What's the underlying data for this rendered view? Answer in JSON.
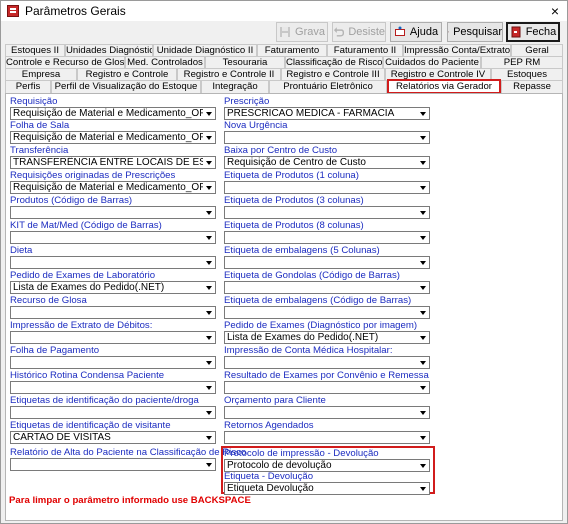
{
  "window": {
    "title": "Parâmetros Gerais",
    "close_glyph": "×"
  },
  "toolbar": {
    "grava": "Grava",
    "desiste": "Desiste",
    "ajuda": "Ajuda",
    "pesquisar": "Pesquisar",
    "fecha": "Fecha"
  },
  "tabs": {
    "row1": [
      "Estoques II",
      "Unidades Diagnóstico",
      "Unidade Diagnóstico II",
      "Faturamento",
      "Faturamento II",
      "Impressão Conta/Extrato",
      "Geral"
    ],
    "row2": [
      "Controle e Recurso de Glosas",
      "Med. Controlados",
      "Tesouraria",
      "Classificação de Risco",
      "Cuidados do Paciente",
      "PEP RM"
    ],
    "row3": [
      "Empresa",
      "Registro e Controle",
      "Registro e Controle II",
      "Registro e Controle III",
      "Registro e Controle IV",
      "Estoques"
    ],
    "row4": [
      "Perfis",
      "Perfil de Visualização do Estoque",
      "Integração",
      "Prontuário Eletrônico",
      "Relatórios via Gerador",
      "Repasse"
    ],
    "selected": "Relatórios via Gerador"
  },
  "left": [
    {
      "label": "Requisição",
      "value": "Requisição de Material e Medicamento_OF"
    },
    {
      "label": "Folha de Sala",
      "value": "Requisição de Material e Medicamento_OF"
    },
    {
      "label": "Transferência",
      "value": "TRANSFERÊNCIA ENTRE LOCAIS DE ESTOQUE"
    },
    {
      "label": "Requisições originadas de Prescrições",
      "value": "Requisição de Material e Medicamento_OF"
    },
    {
      "label": "Produtos (Código de Barras)",
      "value": ""
    },
    {
      "label": "KIT de Mat/Med (Código de Barras)",
      "value": ""
    },
    {
      "label": "Dieta",
      "value": ""
    },
    {
      "label": "Pedido de Exames de Laboratório",
      "value": "Lista de Exames do Pedido(.NET)"
    },
    {
      "label": "Recurso de Glosa",
      "value": ""
    },
    {
      "label": "Impressão de Extrato de Débitos:",
      "value": ""
    },
    {
      "label": "Folha de Pagamento",
      "value": ""
    },
    {
      "label": "Histórico Rotina Condensa Paciente",
      "value": ""
    },
    {
      "label": "Etiquetas de identificação do paciente/droga",
      "value": ""
    },
    {
      "label": "Etiquetas de identificação de visitante",
      "value": "CARTAO DE VISITAS"
    },
    {
      "label": "Relatório de Alta do Paciente na Classificação de Risco",
      "value": ""
    }
  ],
  "right": [
    {
      "label": "Prescrição",
      "value": "PRESCRICAO MEDICA - FARMACIA"
    },
    {
      "label": "Nova Urgência",
      "value": ""
    },
    {
      "label": "Baixa por Centro de Custo",
      "value": "Requisição de Centro de Custo"
    },
    {
      "label": "Etiqueta de Produtos (1 coluna)",
      "value": ""
    },
    {
      "label": "Etiqueta de Produtos (3 colunas)",
      "value": ""
    },
    {
      "label": "Etiqueta de Produtos (8 colunas)",
      "value": ""
    },
    {
      "label": "Etiqueta de embalagens (5 Colunas)",
      "value": ""
    },
    {
      "label": "Etiqueta de Gondolas (Código de Barras)",
      "value": ""
    },
    {
      "label": "Etiqueta de embalagens (Código de Barras)",
      "value": ""
    },
    {
      "label": "Pedido de Exames (Diagnóstico por imagem)",
      "value": "Lista de Exames do Pedido(.NET)"
    },
    {
      "label": "Impressão de Conta Médica Hospitalar:",
      "value": ""
    },
    {
      "label": "Resultado de Exames por Convênio e Remessa",
      "value": ""
    },
    {
      "label": "Orçamento para Cliente",
      "value": ""
    },
    {
      "label": "Retornos Agendados",
      "value": ""
    },
    {
      "label": "Protocolo de impressão - Devolução",
      "value": "Protocolo de devolução"
    },
    {
      "label": "Etiqueta - Devolução",
      "value": "Etiqueta Devolução"
    }
  ],
  "footnote": "Para limpar o parâmetro informado use BACKSPACE"
}
